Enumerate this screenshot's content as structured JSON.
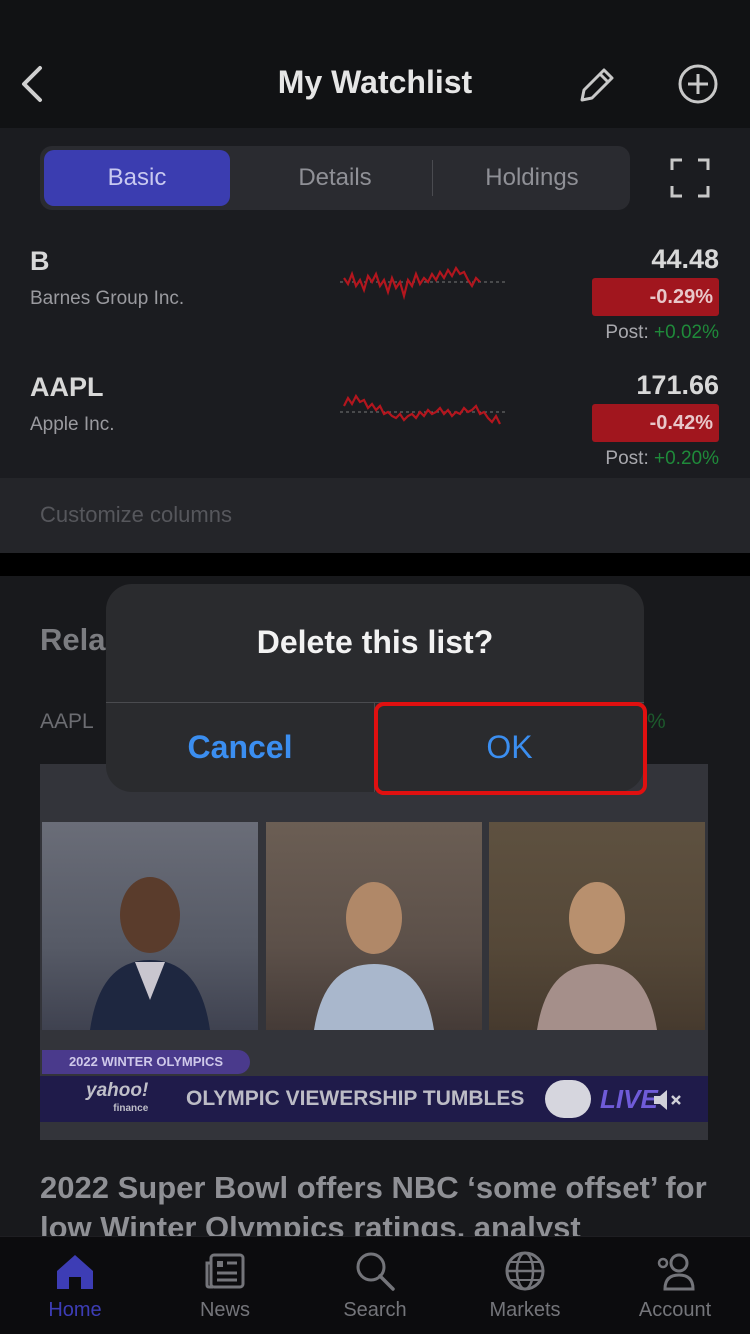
{
  "header": {
    "title": "My Watchlist",
    "back_icon": "chevron-left-icon",
    "edit_icon": "pencil-icon",
    "add_icon": "plus-circle-icon"
  },
  "segments": {
    "items": [
      "Basic",
      "Details",
      "Holdings"
    ],
    "selected": "Basic",
    "expand_icon": "fullscreen-icon"
  },
  "watchlist": [
    {
      "symbol": "B",
      "name": "Barnes Group Inc.",
      "price": "44.48",
      "change": "-0.29%",
      "post_label": "Post:",
      "post_change": "+0.02%"
    },
    {
      "symbol": "AAPL",
      "name": "Apple Inc.",
      "price": "171.66",
      "change": "-0.42%",
      "post_label": "Post:",
      "post_change": "+0.20%"
    }
  ],
  "customize_label": "Customize columns",
  "related": {
    "title": "Rela",
    "symbol": "AAPL",
    "pct_fragment": "%",
    "video": {
      "badge": "2022 WINTER OLYMPICS",
      "logo_top": "yahoo!",
      "logo_bottom": "finance",
      "ticker": "OLYMPIC VIEWERSHIP TUMBLES",
      "live": "LIVE"
    },
    "headline": "2022 Super Bowl offers NBC ‘some offset’ for low Winter Olympics ratings, analyst"
  },
  "dialog": {
    "title": "Delete this list?",
    "cancel": "Cancel",
    "ok": "OK"
  },
  "tabbar": {
    "items": [
      {
        "label": "Home",
        "icon": "home-icon",
        "active": true
      },
      {
        "label": "News",
        "icon": "news-icon",
        "active": false
      },
      {
        "label": "Search",
        "icon": "search-icon",
        "active": false
      },
      {
        "label": "Markets",
        "icon": "globe-icon",
        "active": false
      },
      {
        "label": "Account",
        "icon": "account-settings-icon",
        "active": false
      }
    ]
  },
  "colors": {
    "accent": "#3b3db0",
    "negative": "#a1161e",
    "positive": "#1f8a3a",
    "link": "#3b8ef0",
    "highlight": "#e01010"
  }
}
